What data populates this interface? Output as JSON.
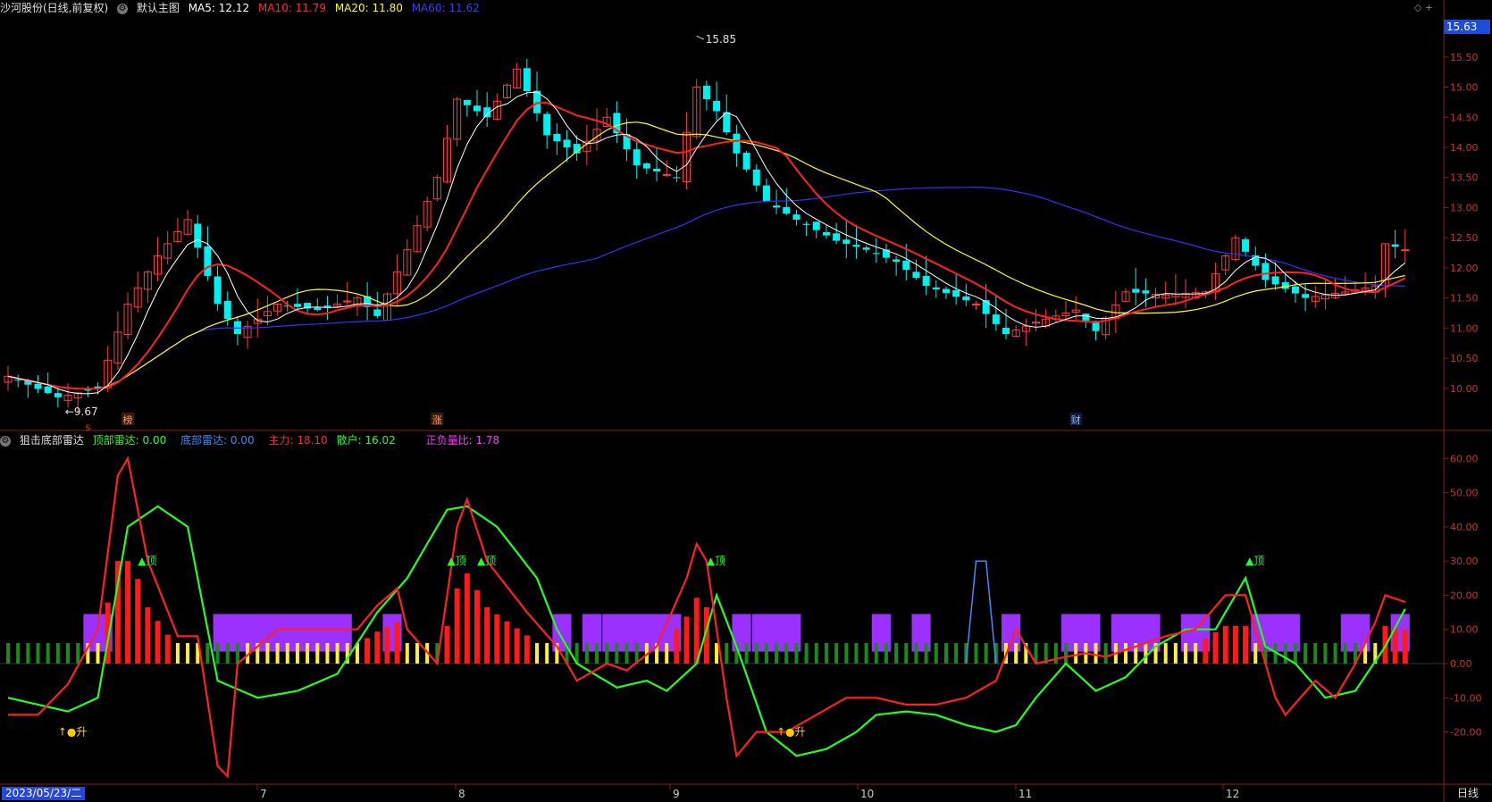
{
  "header": {
    "stock_name": "沙河股份(日线,前复权)",
    "main_chart_label": "默认主图",
    "ma5": "MA5: 12.12",
    "ma10": "MA10: 11.79",
    "ma20": "MA20: 11.80",
    "ma60": "MA60: 11.62",
    "color_ma5": "#ffffff",
    "color_ma10": "#ff2020",
    "color_ma20": "#ffff00",
    "color_ma60": "#3030ff"
  },
  "indicator": {
    "name": "狙击底部雷达",
    "top_radar": "顶部雷达: 0.00",
    "bottom_radar": "底部雷达: 0.00",
    "main_force": "主力: 18.10",
    "retail": "散户: 16.02",
    "ratio": "正负量比: 1.78"
  },
  "price_badge": "15.63",
  "date_label": "2023/05/23/二",
  "period_button": "日线",
  "markers": {
    "high": "15.85",
    "low": "←9.67",
    "bang": "榜",
    "zhang": "涨",
    "cai": "财",
    "s": "S",
    "ding": "▲顶",
    "sheng": "↑●升"
  },
  "chart_data": [
    {
      "type": "candlestick",
      "title": "沙河股份(日线,前复权)",
      "y_ticks": [
        "15.50",
        "15.00",
        "14.50",
        "14.00",
        "13.50",
        "13.00",
        "12.50",
        "12.00",
        "11.50",
        "11.00",
        "10.50",
        "10.00"
      ],
      "ylim": [
        9.3,
        16.15
      ],
      "x_ticks": [
        "7",
        "8",
        "9",
        "10",
        "11",
        "12"
      ],
      "n_bars": 141,
      "anchors": [
        [
          0,
          10.2
        ],
        [
          5,
          9.85
        ],
        [
          9,
          10.0
        ],
        [
          12,
          11.4
        ],
        [
          15,
          12.2
        ],
        [
          18,
          12.8
        ],
        [
          21,
          11.4
        ],
        [
          23,
          10.9
        ],
        [
          27,
          11.4
        ],
        [
          31,
          11.3
        ],
        [
          35,
          11.5
        ],
        [
          37,
          11.2
        ],
        [
          40,
          12.3
        ],
        [
          43,
          13.5
        ],
        [
          45,
          14.8
        ],
        [
          48,
          14.5
        ],
        [
          51,
          15.3
        ],
        [
          54,
          14.2
        ],
        [
          57,
          13.9
        ],
        [
          60,
          14.5
        ],
        [
          63,
          13.7
        ],
        [
          67,
          13.5
        ],
        [
          69,
          15.0
        ],
        [
          71,
          14.6
        ],
        [
          73,
          13.9
        ],
        [
          76,
          13.1
        ],
        [
          79,
          12.8
        ],
        [
          83,
          12.45
        ],
        [
          86,
          12.3
        ],
        [
          89,
          12.1
        ],
        [
          92,
          11.7
        ],
        [
          97,
          11.4
        ],
        [
          100,
          10.9
        ],
        [
          103,
          11.1
        ],
        [
          107,
          11.3
        ],
        [
          109,
          10.95
        ],
        [
          112,
          11.6
        ],
        [
          116,
          11.55
        ],
        [
          120,
          11.6
        ],
        [
          123,
          12.5
        ],
        [
          126,
          11.8
        ],
        [
          130,
          11.5
        ],
        [
          134,
          11.6
        ],
        [
          137,
          11.7
        ],
        [
          138,
          12.4
        ],
        [
          140,
          12.3
        ]
      ],
      "annotations": [
        {
          "x": 69,
          "y": 15.85,
          "text": "15.85"
        },
        {
          "x": 5,
          "y": 9.67,
          "text": "←9.67"
        }
      ],
      "series": [
        {
          "name": "MA5",
          "color": "#ffffff",
          "last": 12.12
        },
        {
          "name": "MA10",
          "color": "#ff2020",
          "last": 11.79
        },
        {
          "name": "MA20",
          "color": "#ffff00",
          "last": 11.8
        },
        {
          "name": "MA60",
          "color": "#3030ff",
          "last": 11.62
        }
      ]
    },
    {
      "type": "line",
      "title": "狙击底部雷达",
      "y_ticks": [
        "60.00",
        "50.00",
        "40.00",
        "30.00",
        "20.00",
        "10.00",
        "0.00",
        "-10.00",
        "-20.00"
      ],
      "ylim": [
        -35,
        64
      ],
      "series": [
        {
          "name": "主力",
          "color": "#ff2020",
          "last": 18.1,
          "anchors": [
            [
              0,
              -15
            ],
            [
              3,
              -15
            ],
            [
              6,
              -6
            ],
            [
              9,
              10
            ],
            [
              11,
              55
            ],
            [
              12,
              60
            ],
            [
              14,
              30
            ],
            [
              17,
              8
            ],
            [
              19,
              8
            ],
            [
              21,
              -30
            ],
            [
              22,
              -33
            ],
            [
              23,
              0
            ],
            [
              27,
              10
            ],
            [
              31,
              10
            ],
            [
              35,
              10
            ],
            [
              37,
              17
            ],
            [
              39,
              22
            ],
            [
              40,
              10
            ],
            [
              43,
              0
            ],
            [
              45,
              40
            ],
            [
              46,
              48
            ],
            [
              48,
              30
            ],
            [
              52,
              15
            ],
            [
              55,
              5
            ],
            [
              57,
              -5
            ],
            [
              60,
              0
            ],
            [
              62,
              -2
            ],
            [
              65,
              5
            ],
            [
              68,
              25
            ],
            [
              69,
              35
            ],
            [
              70,
              30
            ],
            [
              72,
              -10
            ],
            [
              73,
              -27
            ],
            [
              75,
              -20
            ],
            [
              78,
              -20
            ],
            [
              81,
              -15
            ],
            [
              84,
              -10
            ],
            [
              87,
              -10
            ],
            [
              90,
              -12
            ],
            [
              93,
              -12
            ],
            [
              96,
              -10
            ],
            [
              99,
              -5
            ],
            [
              101,
              10
            ],
            [
              103,
              0
            ],
            [
              106,
              2
            ],
            [
              108,
              3
            ],
            [
              110,
              2
            ],
            [
              113,
              5
            ],
            [
              116,
              8
            ],
            [
              119,
              10
            ],
            [
              122,
              20
            ],
            [
              124,
              20
            ],
            [
              127,
              -10
            ],
            [
              128,
              -15
            ],
            [
              131,
              -5
            ],
            [
              133,
              -10
            ],
            [
              135,
              0
            ],
            [
              137,
              12
            ],
            [
              138,
              20
            ],
            [
              140,
              18
            ]
          ]
        },
        {
          "name": "散户",
          "color": "#20ff20",
          "last": 16.02,
          "anchors": [
            [
              0,
              -10
            ],
            [
              3,
              -12
            ],
            [
              6,
              -14
            ],
            [
              9,
              -10
            ],
            [
              12,
              40
            ],
            [
              15,
              46
            ],
            [
              18,
              40
            ],
            [
              21,
              -5
            ],
            [
              25,
              -10
            ],
            [
              29,
              -8
            ],
            [
              33,
              -3
            ],
            [
              37,
              15
            ],
            [
              40,
              25
            ],
            [
              44,
              45
            ],
            [
              46,
              46
            ],
            [
              49,
              40
            ],
            [
              53,
              25
            ],
            [
              55,
              10
            ],
            [
              57,
              0
            ],
            [
              61,
              -7
            ],
            [
              64,
              -5
            ],
            [
              66,
              -8
            ],
            [
              69,
              0
            ],
            [
              71,
              20
            ],
            [
              73,
              5
            ],
            [
              76,
              -20
            ],
            [
              79,
              -27
            ],
            [
              82,
              -25
            ],
            [
              85,
              -20
            ],
            [
              87,
              -15
            ],
            [
              90,
              -14
            ],
            [
              93,
              -15
            ],
            [
              96,
              -18
            ],
            [
              99,
              -20
            ],
            [
              101,
              -18
            ],
            [
              103,
              -10
            ],
            [
              106,
              0
            ],
            [
              109,
              -8
            ],
            [
              112,
              -4
            ],
            [
              115,
              5
            ],
            [
              118,
              10
            ],
            [
              121,
              10
            ],
            [
              124,
              25
            ],
            [
              126,
              5
            ],
            [
              129,
              0
            ],
            [
              132,
              -10
            ],
            [
              135,
              -8
            ],
            [
              138,
              5
            ],
            [
              140,
              16
            ]
          ]
        },
        {
          "name": "底部雷达",
          "color": "#3a8cff",
          "last": 0.0,
          "anchors": [
            [
              96,
              0
            ],
            [
              97,
              30
            ],
            [
              98,
              30
            ],
            [
              99,
              0
            ]
          ]
        }
      ],
      "signals": [
        {
          "x": 13,
          "text": "▲顶"
        },
        {
          "x": 44,
          "text": "▲顶"
        },
        {
          "x": 47,
          "text": "▲顶"
        },
        {
          "x": 70,
          "text": "▲顶"
        },
        {
          "x": 124,
          "text": "▲顶"
        },
        {
          "x": 5,
          "text": "↑●升"
        },
        {
          "x": 77,
          "text": "↑●升"
        }
      ],
      "purple_blocks": [
        [
          8,
          10
        ],
        [
          21,
          34
        ],
        [
          38,
          39
        ],
        [
          55,
          56
        ],
        [
          58,
          59
        ],
        [
          60,
          67
        ],
        [
          73,
          74
        ],
        [
          75,
          79
        ],
        [
          87,
          88
        ],
        [
          91,
          92
        ],
        [
          100,
          101
        ],
        [
          106,
          109
        ],
        [
          111,
          115
        ],
        [
          118,
          120
        ],
        [
          125,
          129
        ],
        [
          134,
          136
        ],
        [
          139,
          140
        ]
      ]
    }
  ]
}
